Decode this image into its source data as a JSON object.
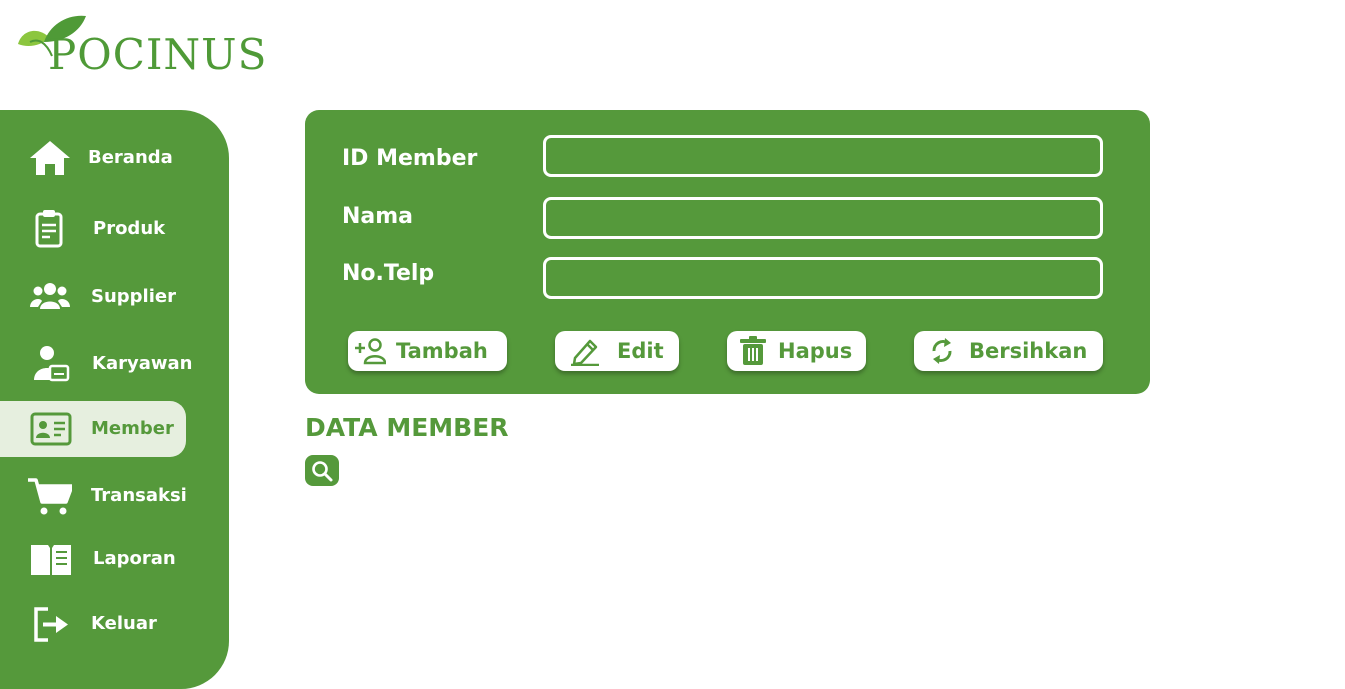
{
  "app": {
    "logo_text": "POCINUS"
  },
  "sidebar": {
    "items": [
      {
        "label": "Beranda",
        "icon": "home-icon"
      },
      {
        "label": "Produk",
        "icon": "clipboard-icon"
      },
      {
        "label": "Supplier",
        "icon": "users-icon"
      },
      {
        "label": "Karyawan",
        "icon": "employee-icon"
      },
      {
        "label": "Member",
        "icon": "id-card-icon",
        "active": true
      },
      {
        "label": "Transaksi",
        "icon": "cart-icon"
      },
      {
        "label": "Laporan",
        "icon": "book-icon"
      },
      {
        "label": "Keluar",
        "icon": "logout-icon"
      }
    ]
  },
  "form": {
    "fields": [
      {
        "label": "ID Member",
        "value": ""
      },
      {
        "label": "Nama",
        "value": ""
      },
      {
        "label": "No.Telp",
        "value": ""
      }
    ],
    "buttons": {
      "add": "Tambah",
      "edit": "Edit",
      "delete": "Hapus",
      "clear": "Bersihkan"
    }
  },
  "data_section": {
    "title": "DATA MEMBER",
    "search_icon": "search-icon"
  },
  "colors": {
    "primary": "#55993b",
    "active_bg": "#e6efdf",
    "white": "#ffffff"
  }
}
